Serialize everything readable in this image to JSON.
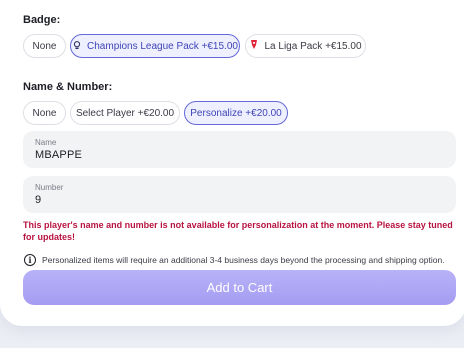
{
  "badge": {
    "label": "Badge:",
    "options": [
      {
        "label": "None",
        "icon": ""
      },
      {
        "label": "Champions League Pack +€15.00",
        "icon": "champions-league-icon"
      },
      {
        "label": "La Liga Pack +€15.00",
        "icon": "la-liga-icon"
      }
    ],
    "selected": "Champions League Pack +€15.00"
  },
  "name_number": {
    "label": "Name & Number:",
    "options": [
      {
        "label": "None"
      },
      {
        "label": "Select Player +€20.00"
      },
      {
        "label": "Personalize +€20.00"
      }
    ],
    "selected": "Personalize +€20.00"
  },
  "fields": {
    "name": {
      "label": "Name",
      "value": "MBAPPE"
    },
    "number": {
      "label": "Number",
      "value": "9"
    }
  },
  "error_text": "This player's name and number is not available for personalization at the moment. Please stay tuned for updates!",
  "info_text": "Personalized items will require an additional 3-4 business days beyond the processing and shipping option.",
  "add_to_cart_label": "Add to Cart",
  "colors": {
    "accent": "#6468d8",
    "error": "#b81340",
    "button": "#a59cf2"
  }
}
